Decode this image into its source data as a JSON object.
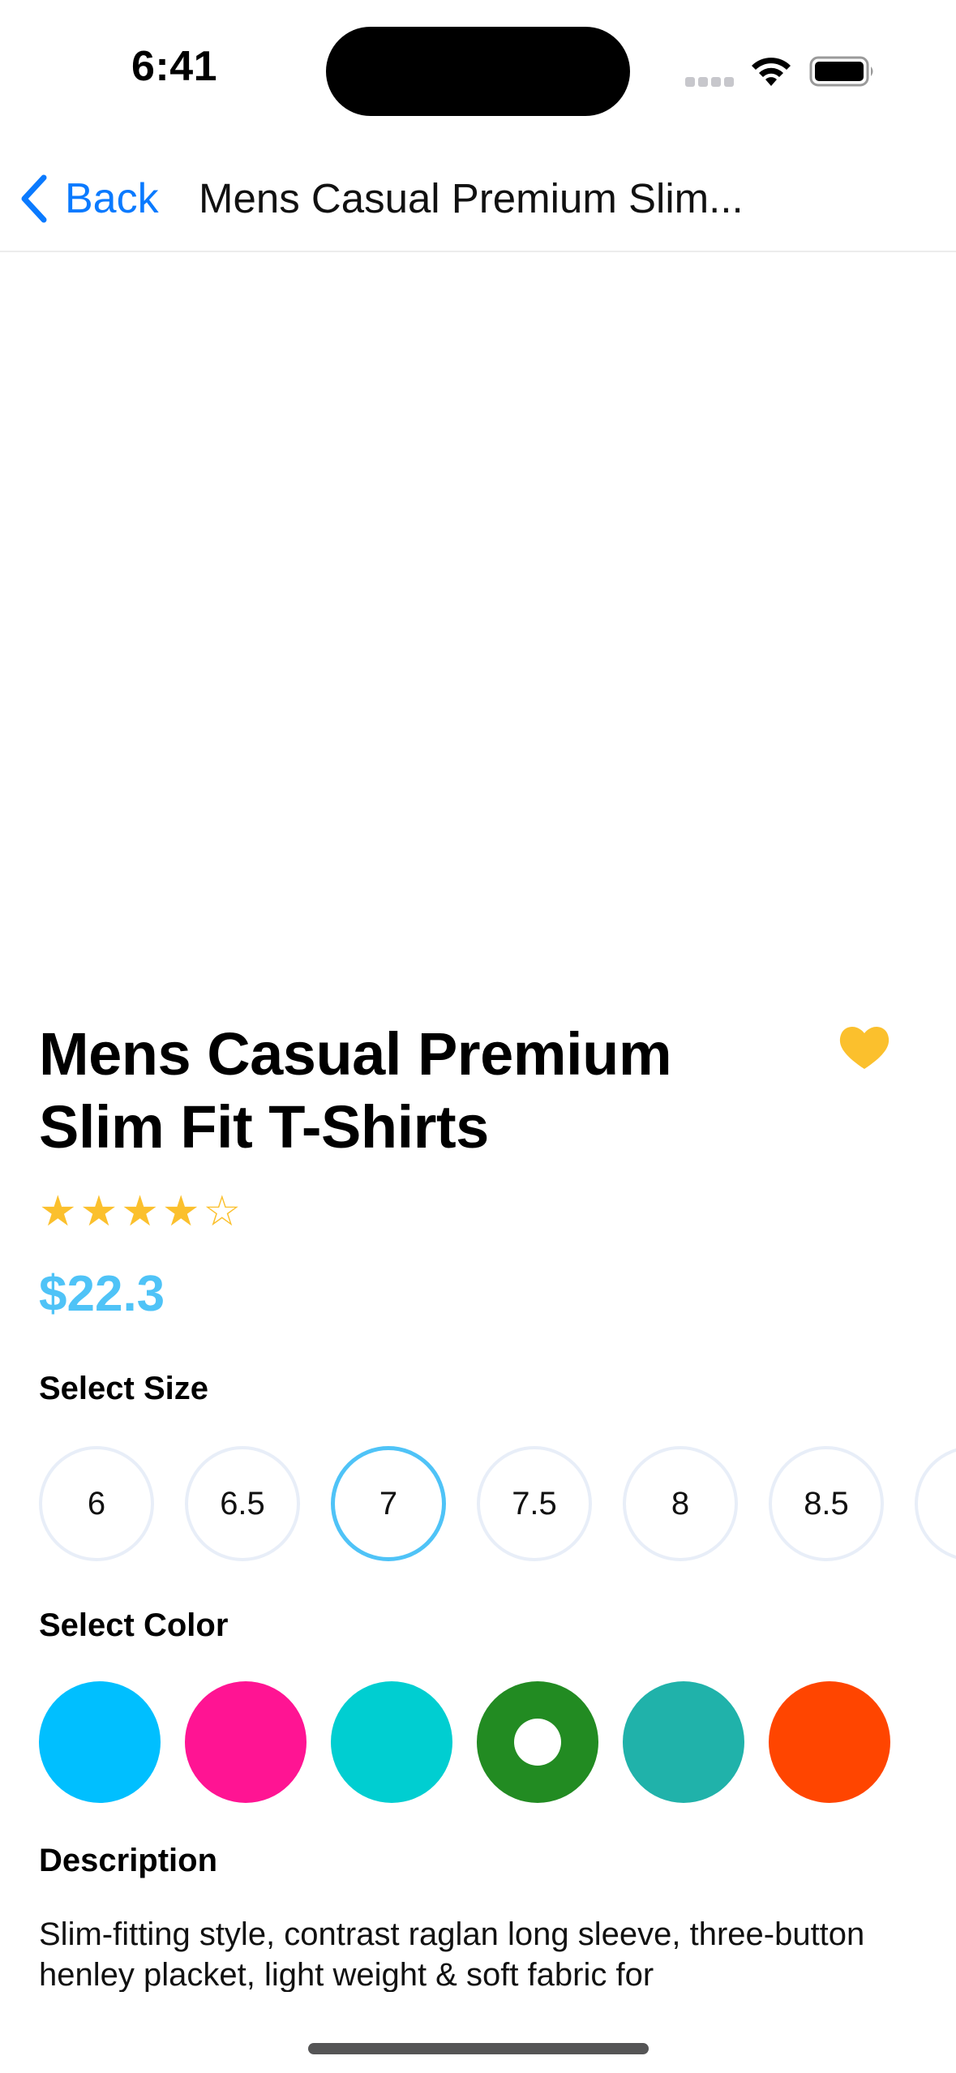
{
  "status_bar": {
    "time": "6:41"
  },
  "nav": {
    "back_label": "Back",
    "title": "Mens Casual Premium Slim..."
  },
  "product": {
    "title": "Mens Casual Premium Slim Fit T-Shirts",
    "rating": 4,
    "rating_max": 5,
    "price": "$22.3",
    "favorite": true
  },
  "size_section": {
    "label": "Select Size",
    "options": [
      "6",
      "6.5",
      "7",
      "7.5",
      "8",
      "8.5"
    ],
    "selected": "7"
  },
  "color_section": {
    "label": "Select Color",
    "options": [
      "#00bfff",
      "#ff1493",
      "#00ced1",
      "#228b22",
      "#20b2aa",
      "#ff4500"
    ],
    "selected_index": 3
  },
  "description_section": {
    "label": "Description",
    "text": "Slim-fitting style, contrast raglan long sleeve, three-button henley placket, light weight & soft fabric for"
  },
  "colors": {
    "accent_blue": "#0a7aff",
    "price_blue": "#4fc3f7",
    "star_yellow": "#fbc02d"
  }
}
